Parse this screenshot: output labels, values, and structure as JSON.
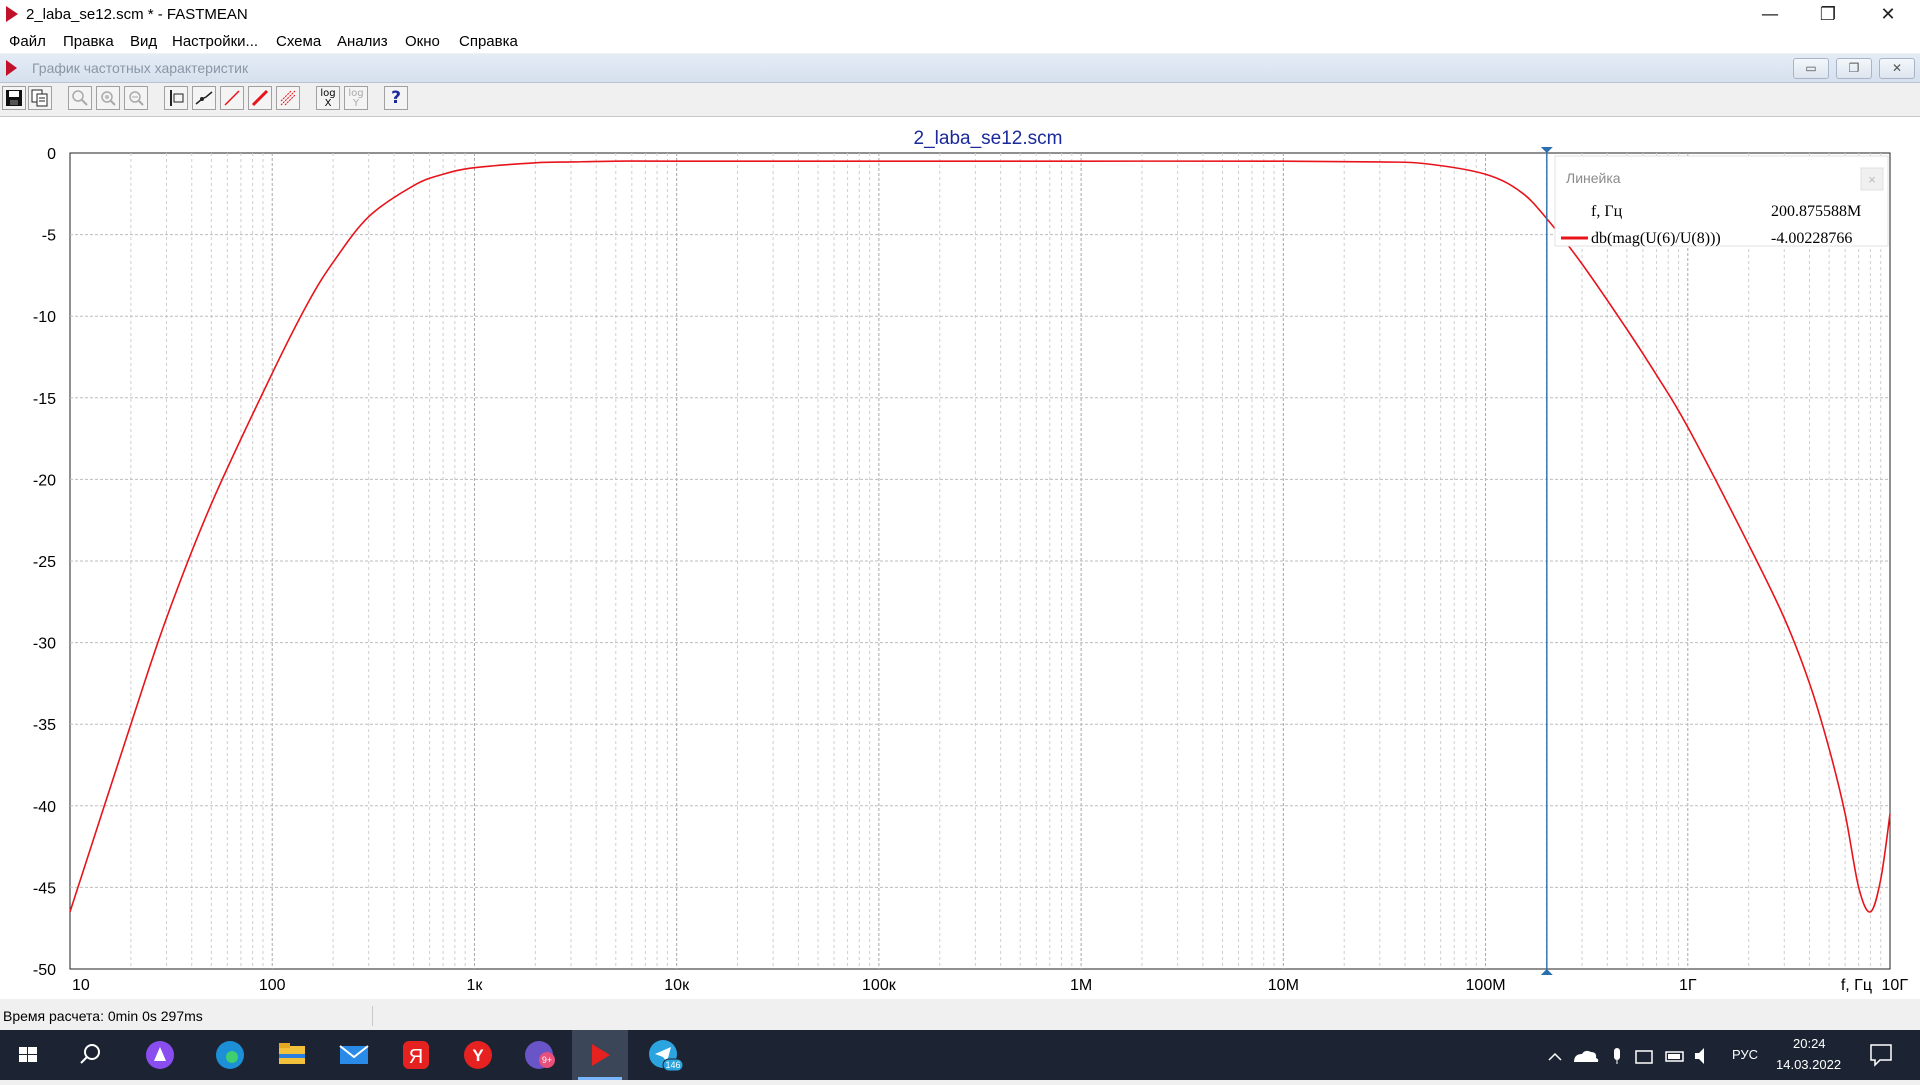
{
  "window": {
    "title": "2_laba_se12.scm * - FASTMEAN",
    "minimize": "—",
    "maximize": "❐",
    "close": "✕"
  },
  "menu": [
    "Файл",
    "Правка",
    "Вид",
    "Настройки...",
    "Схема",
    "Анализ",
    "Окно",
    "Справка"
  ],
  "child_window": {
    "title": "График частотных характеристик",
    "min": "▭",
    "restore": "❐",
    "close": "✕"
  },
  "toolbar": {
    "icons": [
      "save-icon",
      "copy-icon",
      "zoom-icon",
      "zoom-in-icon",
      "zoom-out-icon",
      "cursor-icon",
      "trace-icon",
      "line-icon",
      "red-line-icon",
      "grid-icon",
      "log-x-icon",
      "log-y-icon",
      "help-icon"
    ],
    "log_x": "log X",
    "log_y": "log Y",
    "help": "?"
  },
  "status": {
    "calc_time": "Время расчета: 0min 0s 297ms"
  },
  "ruler": {
    "title": "Линейка",
    "freq_label": "f, Гц",
    "freq_value": "200.875588M",
    "trace_label": "db(mag(U(6)/U(8)))",
    "trace_value": "-4.00228766",
    "close": "×"
  },
  "chart_data": {
    "type": "line",
    "title": "2_laba_se12.scm",
    "xlabel": "f, Гц",
    "ylabel": "",
    "x_scale": "log",
    "xlim": [
      10,
      10000000000
    ],
    "ylim": [
      -50,
      0
    ],
    "grid": true,
    "x_ticks": [
      "10",
      "100",
      "1к",
      "10к",
      "100к",
      "1М",
      "10М",
      "100М",
      "1Г",
      "10Г"
    ],
    "y_ticks": [
      0,
      -5,
      -10,
      -15,
      -20,
      -25,
      -30,
      -35,
      -40,
      -45,
      -50
    ],
    "cursor_x": 200875588,
    "series": [
      {
        "name": "db(mag(U(6)/U(8)))",
        "color": "#e8141c",
        "x": [
          10,
          20,
          30,
          50,
          100,
          150,
          200,
          300,
          500,
          700,
          1000,
          2000,
          3000,
          5000,
          10000,
          100000,
          1000000,
          10000000,
          30000000,
          50000000,
          100000000,
          150000000,
          200000000,
          300000000,
          500000000,
          700000000,
          1000000000,
          2000000000,
          3000000000,
          4000000000,
          5000000000,
          6000000000,
          7000000000,
          8000000000,
          9000000000,
          10000000000
        ],
        "y": [
          -46.5,
          -35.0,
          -28.5,
          -21.5,
          -13.5,
          -9.2,
          -6.7,
          -3.9,
          -2.0,
          -1.3,
          -0.9,
          -0.6,
          -0.55,
          -0.5,
          -0.5,
          -0.5,
          -0.5,
          -0.5,
          -0.55,
          -0.65,
          -1.3,
          -2.4,
          -4.0,
          -6.8,
          -10.8,
          -13.6,
          -16.8,
          -24.0,
          -28.5,
          -32.5,
          -36.5,
          -40.5,
          -45.0,
          -46.5,
          -44.5,
          -40.5
        ]
      }
    ]
  },
  "taskbar": {
    "apps": [
      "windows-start-icon",
      "search-icon",
      "alice-icon",
      "edge-icon",
      "explorer-icon",
      "mail-icon",
      "yandex-icon",
      "yandex-browser-icon",
      "app-badge-icon",
      "fastmean-icon",
      "telegram-icon"
    ],
    "badge_9": "9+",
    "badge_146": "146",
    "lang": "РУС",
    "time": "20:24",
    "date": "14.03.2022"
  }
}
